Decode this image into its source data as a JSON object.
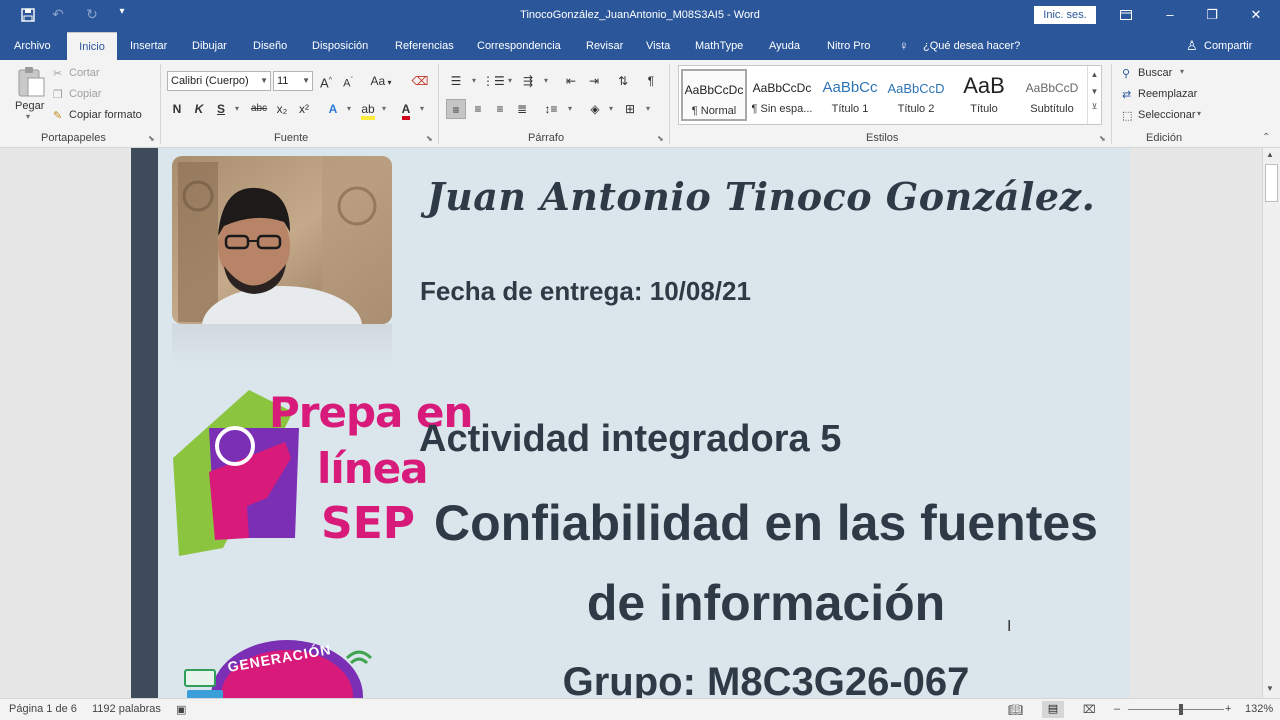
{
  "window": {
    "title": "TinocoGonzález_JuanAntonio_M08S3AI5 - Word",
    "signin_label": "Inic. ses."
  },
  "tabs": [
    "Archivo",
    "Inicio",
    "Insertar",
    "Dibujar",
    "Diseño",
    "Disposición",
    "Referencias",
    "Correspondencia",
    "Revisar",
    "Vista",
    "MathType",
    "Ayuda",
    "Nitro Pro"
  ],
  "active_tab": "Inicio",
  "tell_me": "¿Qué desea hacer?",
  "share_label": "Compartir",
  "clipboard": {
    "paste": "Pegar",
    "cut": "Cortar",
    "copy": "Copiar",
    "format_painter": "Copiar formato",
    "group": "Portapapeles"
  },
  "font": {
    "name": "Calibri (Cuerpo)",
    "size": "11",
    "group": "Fuente",
    "grow": "A",
    "shrink": "A",
    "case": "Aa",
    "bold": "N",
    "italic": "K",
    "underline": "S",
    "strike": "abc",
    "subscript": "x₂",
    "superscript": "x²"
  },
  "paragraph": {
    "group": "Párrafo"
  },
  "styles": {
    "group": "Estilos",
    "items": [
      {
        "preview": "AaBbCcDc",
        "name": "¶ Normal"
      },
      {
        "preview": "AaBbCcDc",
        "name": "¶ Sin espa..."
      },
      {
        "preview": "AaBbCc",
        "name": "Título 1"
      },
      {
        "preview": "AaBbCcD",
        "name": "Título 2"
      },
      {
        "preview": "AaB",
        "name": "Título"
      },
      {
        "preview": "AaBbCcD",
        "name": "Subtítulo"
      }
    ]
  },
  "editing": {
    "find": "Buscar",
    "replace": "Reemplazar",
    "select": "Seleccionar",
    "group": "Edición"
  },
  "document": {
    "author": "Juan Antonio Tinoco González.",
    "due_date": "Fecha de entrega: 10/08/21",
    "activity": "Actividad integradora 5",
    "title_line1": "Confiabilidad en las fuentes",
    "title_line2": "de información",
    "group": "Grupo: M8C3G26-067",
    "logo_prepa": {
      "line1": "Prepa en",
      "line2": "línea",
      "line3": "SEP"
    },
    "logo_generacion": "GENERACIÓN"
  },
  "status": {
    "page": "Página 1 de 6",
    "words": "1192 palabras",
    "zoom": "132%",
    "zoom_fraction": 0.55
  },
  "colors": {
    "word_blue": "#2b579a",
    "page_bg": "#dbe6ec",
    "stripe": "#3d4b5a",
    "doc_text": "#2e3a46",
    "logo_green": "#8bc53f",
    "logo_purple": "#7a2fb5",
    "logo_pink": "#d81b7a"
  }
}
